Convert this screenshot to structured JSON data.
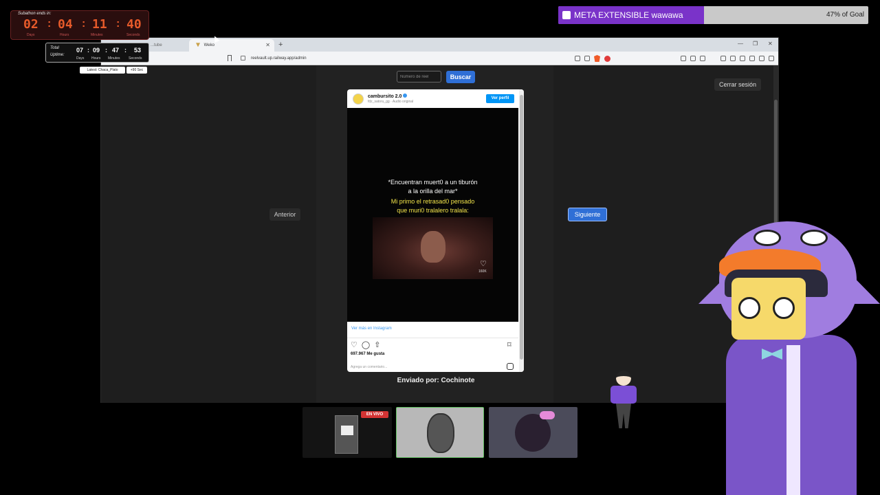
{
  "subathon": {
    "title": "Subathon ends in:",
    "digits": [
      "02",
      "04",
      "11",
      "40"
    ],
    "units": [
      "Days",
      "Hours",
      "Minutes",
      "Seconds"
    ]
  },
  "uptime": {
    "label_top": "Total",
    "label_bottom": "Uptime:",
    "digits": [
      "07",
      "09",
      "47",
      "53"
    ],
    "units": [
      "Days",
      "Hours",
      "Minutes",
      "Seconds"
    ]
  },
  "latest": {
    "label": "Latest: Chaca_Plato",
    "bonus": "+90 Sec"
  },
  "goal": {
    "label": "META EXTENSIBLE wawawa",
    "percent_text": "47% of Goal",
    "progress": 0.47,
    "fill_color": "#7a33c9"
  },
  "browser": {
    "tabs": [
      {
        "title": "...tube",
        "active": false
      },
      {
        "title": "Weko",
        "active": true
      }
    ],
    "new_tab_label": "+",
    "url": "reelvault.up.railway.app/admin"
  },
  "page": {
    "reel_placeholder": "Número de reel",
    "search_button": "Buscar",
    "logout_button": "Cerrar sesión",
    "prev_button": "Anterior",
    "next_button": "Siguiente",
    "submitter": "Enviado por: Cochinote"
  },
  "instagram": {
    "username": "cambursito 2.0",
    "subline": "fdz_satoru_gg · Audio original",
    "view_profile": "Ver perfil",
    "caption_white": [
      "*Encuentran muert0 a un tiburón",
      "a la orilla del mar*"
    ],
    "caption_yellow": [
      "Mi primo el retrasad0 pensado",
      "que muri0 tralalero tralala:"
    ],
    "overlay_likes": "160K",
    "see_more": "Ver más en Instagram",
    "likes": "697.967 Me gusta",
    "comment_placeholder": "Agrega un comentario..."
  },
  "thumbnails": [
    {
      "badge": "EN VIVO"
    }
  ],
  "colors": {
    "accent_blue": "#2f6fd6",
    "timer_orange": "#e65a2a",
    "goal_purple": "#7a33c9"
  }
}
